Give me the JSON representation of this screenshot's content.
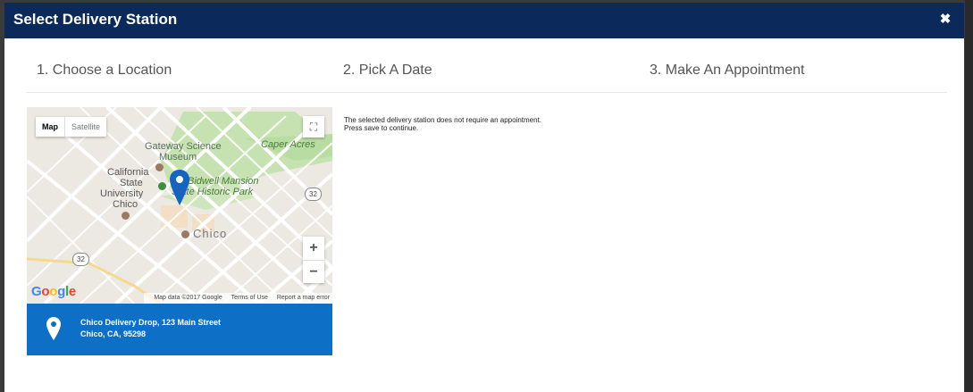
{
  "modal": {
    "title": "Select Delivery Station",
    "close_icon": "close-icon"
  },
  "steps": [
    {
      "label": "1. Choose a Location"
    },
    {
      "label": "2. Pick A Date"
    },
    {
      "label": "3. Make An Appointment"
    }
  ],
  "map": {
    "type_options": {
      "map": "Map",
      "satellite": "Satellite"
    },
    "zoom_in": "+",
    "zoom_out": "−",
    "labels": {
      "gateway": "Gateway Science",
      "museum": "Museum",
      "caper": "Caper Acres",
      "california": "California",
      "state": "State",
      "university": "University",
      "chico_campus": "Chico",
      "bidwell": "Bidwell Mansion",
      "historic_park": "State Historic Park",
      "chico_city": "Chico",
      "route_32a": "32",
      "route_32b": "32"
    },
    "google_logo": [
      "G",
      "o",
      "o",
      "g",
      "l",
      "e"
    ],
    "footer": {
      "map_data": "Map data ©2017 Google",
      "terms": "Terms of Use",
      "report": "Report a map error"
    },
    "colors": {
      "background": "#ece9e3",
      "road": "#ffffff",
      "park": "#b9dca3",
      "pin": "#1565c0"
    }
  },
  "station": {
    "name": "Chico Delivery Drop, 123 Main Street",
    "address": "Chico, CA, 95298",
    "icon": "map-pin-icon"
  },
  "notice": {
    "line1": "The selected delivery station does not require an appointment.",
    "line2": "Press save to continue."
  },
  "colors": {
    "header": "#0b2a5b",
    "station_card": "#0d6fc6"
  }
}
